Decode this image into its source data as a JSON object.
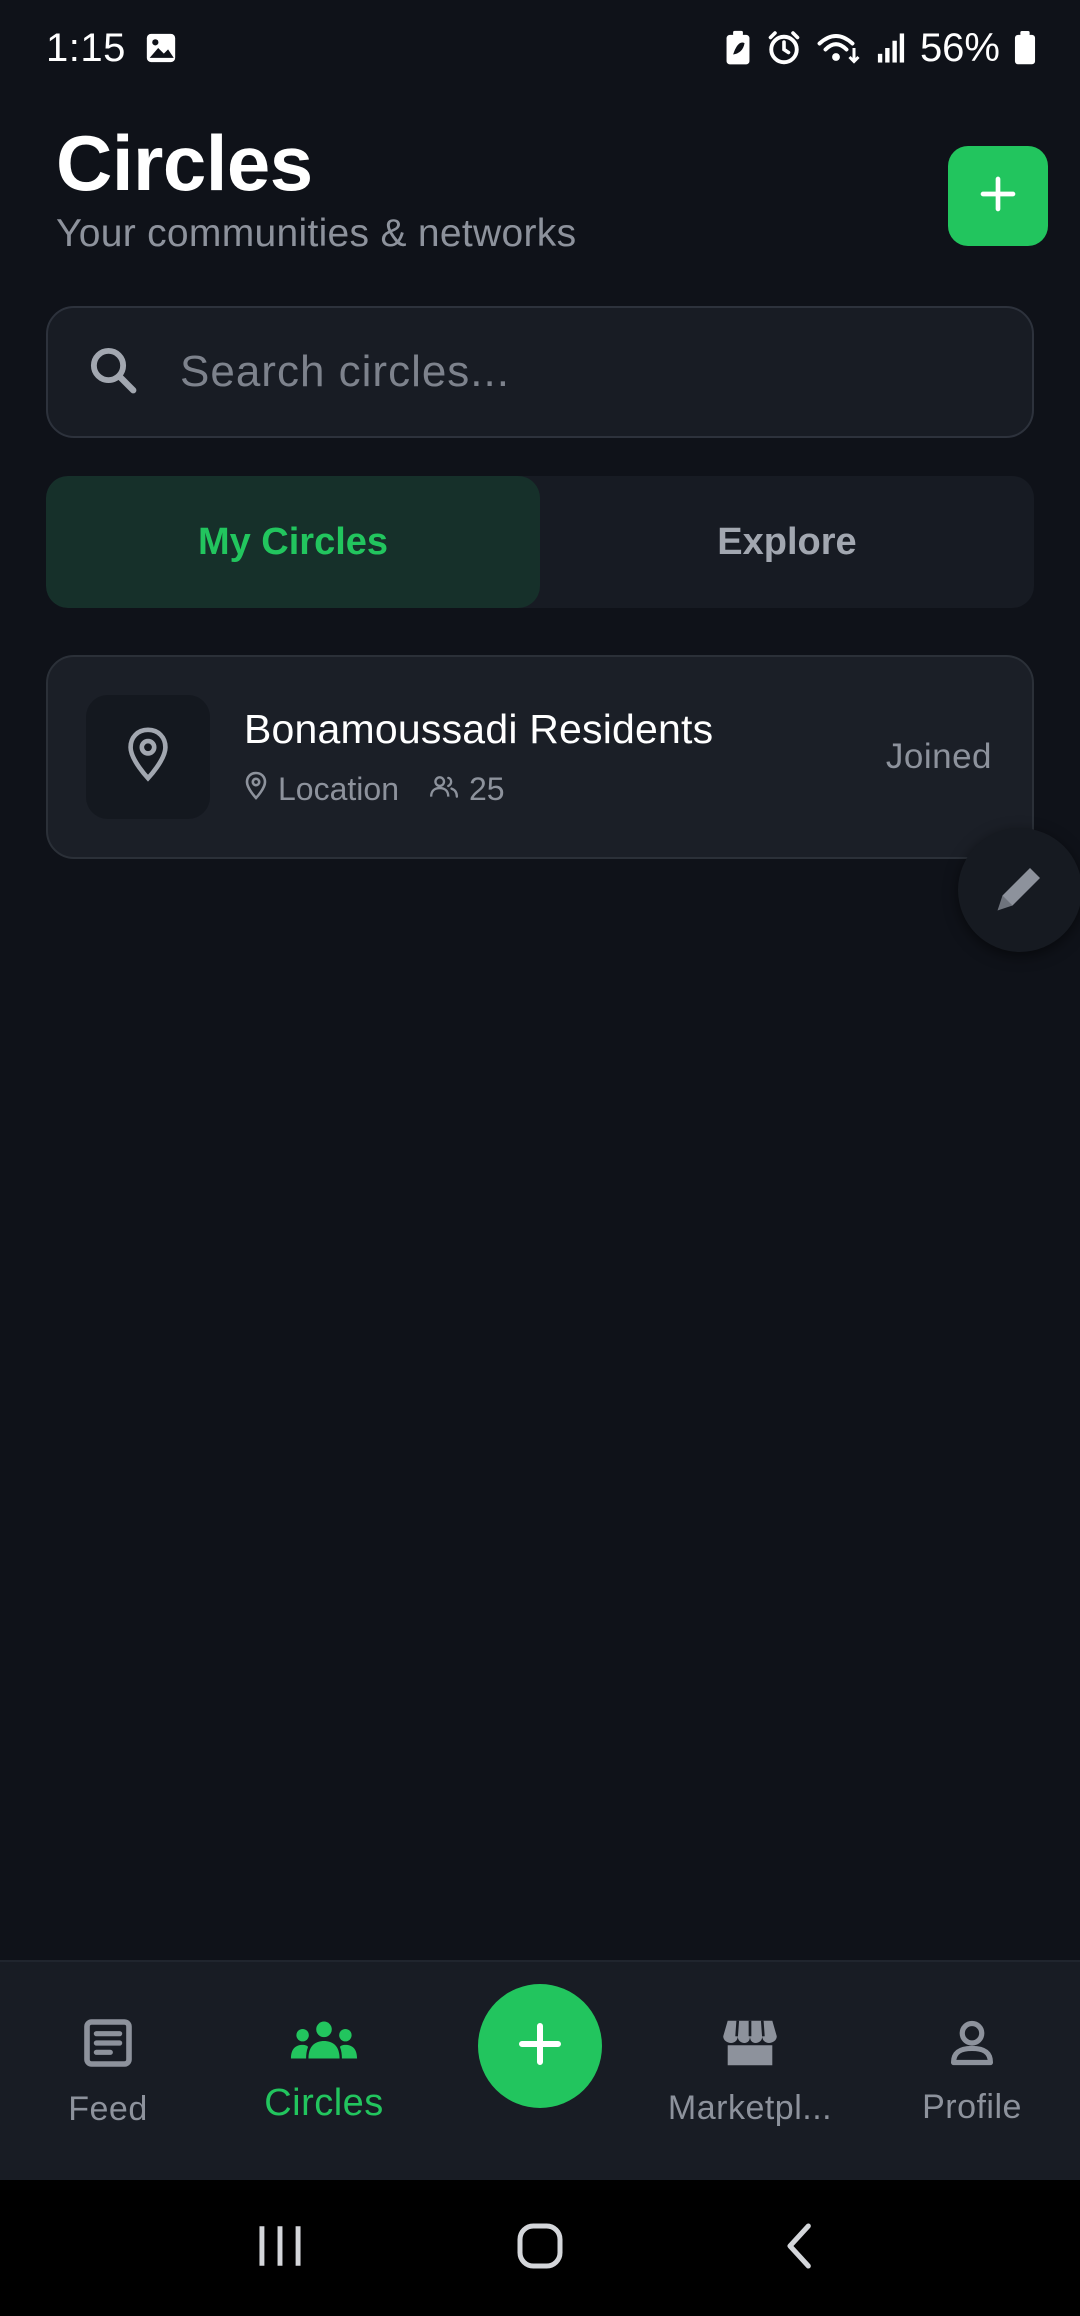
{
  "status_bar": {
    "time": "1:15",
    "battery_percent": "56%",
    "icons": [
      "gallery-icon",
      "battery-saver-icon",
      "alarm-icon",
      "wifi-icon",
      "signal-icon",
      "battery-icon"
    ]
  },
  "header": {
    "title": "Circles",
    "subtitle": "Your communities & networks",
    "add_button_icon": "plus-icon"
  },
  "search": {
    "placeholder": "Search circles...",
    "value": ""
  },
  "tabs": [
    {
      "label": "My Circles",
      "active": true
    },
    {
      "label": "Explore",
      "active": false
    }
  ],
  "circles": [
    {
      "name": "Bonamoussadi Residents",
      "type": "Location",
      "members": "25",
      "status": "Joined",
      "icon": "map-pin-icon"
    }
  ],
  "bottom_nav": {
    "items": [
      {
        "label": "Feed",
        "icon": "feed-icon",
        "active": false
      },
      {
        "label": "Circles",
        "icon": "group-icon",
        "active": true
      },
      {
        "label": "Marketpl...",
        "icon": "store-icon",
        "active": false
      },
      {
        "label": "Profile",
        "icon": "profile-icon",
        "active": false
      }
    ],
    "center_icon": "plus-icon"
  },
  "colors": {
    "background": "#0f1219",
    "accent": "#22c55e",
    "card": "#1b1f27",
    "muted_text": "#8d929c"
  }
}
